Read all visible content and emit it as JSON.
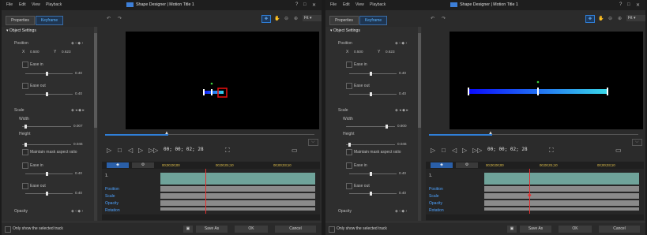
{
  "menus": [
    "File",
    "Edit",
    "View",
    "Playback"
  ],
  "title": "Shape Designer | Motion Title 1",
  "window_controls": [
    "?",
    "□",
    "✕"
  ],
  "tabs": {
    "properties": "Properties",
    "keyframe": "Keyframe"
  },
  "section": "Object Settings",
  "position": {
    "label": "Position",
    "x_label": "X",
    "x": "0.500",
    "y_label": "Y",
    "y": "0.623"
  },
  "ease_in": "Ease in",
  "ease_out": "Ease out",
  "ease_val": "0.40",
  "scale": {
    "label": "Scale",
    "width_label": "Width",
    "height_label": "Height",
    "height_val": "0.046",
    "maintain": "Maintain mask aspect ratio"
  },
  "scale_width_values": [
    "0.007",
    "0.800"
  ],
  "opacity": "Opacity",
  "toolbar": {
    "fit": "Fit"
  },
  "timecode": "00; 00; 02; 28",
  "timeline": {
    "rows": [
      "1.",
      "Position",
      "Scale",
      "Opacity",
      "Rotation"
    ],
    "ruler": [
      "00;00;00;00",
      "00;00;01;10",
      "00;00;03;10"
    ]
  },
  "bottom": {
    "only_show": "Only show the selected track",
    "save_as": "Save As",
    "ok": "OK",
    "cancel": "Cancel"
  },
  "colors": {
    "accent": "#2f7fd8",
    "bar_left": "#0a0aff",
    "bar_right": "#39d8e8",
    "track": "#6fa39a"
  }
}
